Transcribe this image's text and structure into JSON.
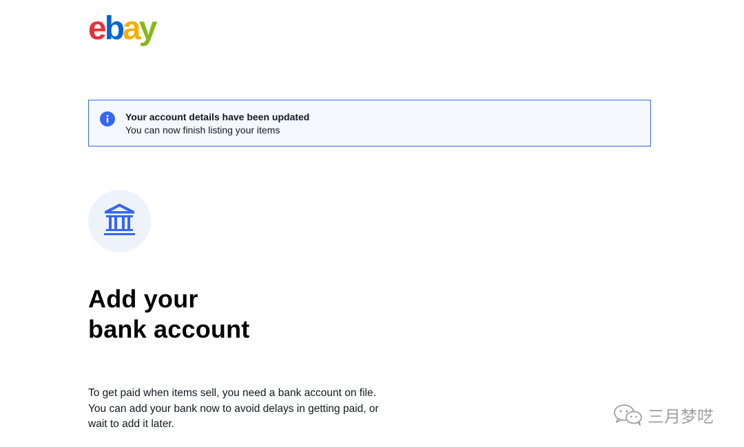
{
  "brand": {
    "logo_text": "ebay",
    "logo_colors": [
      "#e53238",
      "#0064d2",
      "#f5af02",
      "#86b817"
    ]
  },
  "notice": {
    "title": "Your account details have been updated",
    "message": "You can now finish listing your items",
    "icon": "info-icon",
    "accent_color": "#3665f3"
  },
  "bank_icon": "bank-icon",
  "heading": {
    "line1": "Add your",
    "line2": "bank account"
  },
  "body": {
    "line1": "To get paid when items sell, you need a bank account on file.",
    "line2": "You can add your bank now to avoid delays in getting paid, or",
    "line3": "wait to add it later."
  },
  "watermark": {
    "icon": "wechat-icon",
    "label": "三月梦呓"
  }
}
